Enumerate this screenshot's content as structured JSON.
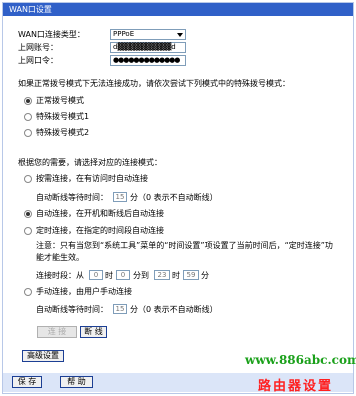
{
  "title": "WAN口设置",
  "fields": {
    "wan_type_label": "WAN口连接类型：",
    "wan_type_value": "PPPoE",
    "account_label": "上网账号：",
    "account_value": "d▓▓▓▓▓▓▓▓▓▓d",
    "password_label": "上网口令：",
    "password_value": "●●●●●●●●●●●●●"
  },
  "special_dial": {
    "prompt": "如果正常拨号模式下无法连接成功，请依次尝试下列模式中的特殊拨号模式：",
    "options": [
      "正常拨号模式",
      "特殊拨号模式1",
      "特殊拨号模式2"
    ],
    "selected": 0
  },
  "connect_mode": {
    "prompt": "根据您的需要，请选择对应的连接模式：",
    "on_demand": "按需连接，在有访问时自动连接",
    "idle_label": "自动断线等待时间：",
    "idle_value": "15",
    "idle_unit": "分（0 表示不自动断线）",
    "auto": "自动连接，在开机和断线后自动连接",
    "timed": "定时连接，在指定的时间段自动连接",
    "note": "注意：只有当您到“系统工具”菜单的“时间设置”项设置了当前时间后，“定时连接”功能才能生效。",
    "period_label": "连接时段：从",
    "from_h": "0",
    "hour1": "时",
    "from_m": "0",
    "to_label": "分到",
    "to_h": "23",
    "hour2": "时",
    "to_m": "59",
    "min_end": "分",
    "manual": "手动连接，由用户手动连接",
    "idle_label2": "自动断线等待时间：",
    "idle_value2": "15",
    "idle_unit2": "分（0 表示不自动断线）",
    "selected": 1
  },
  "buttons": {
    "connect": "连 接",
    "disconnect": "断 线",
    "advanced": "高级设置",
    "save": "保 存",
    "help": "帮 助"
  },
  "watermark": {
    "site": "www.886abc.com",
    "text": "路由器设置"
  }
}
